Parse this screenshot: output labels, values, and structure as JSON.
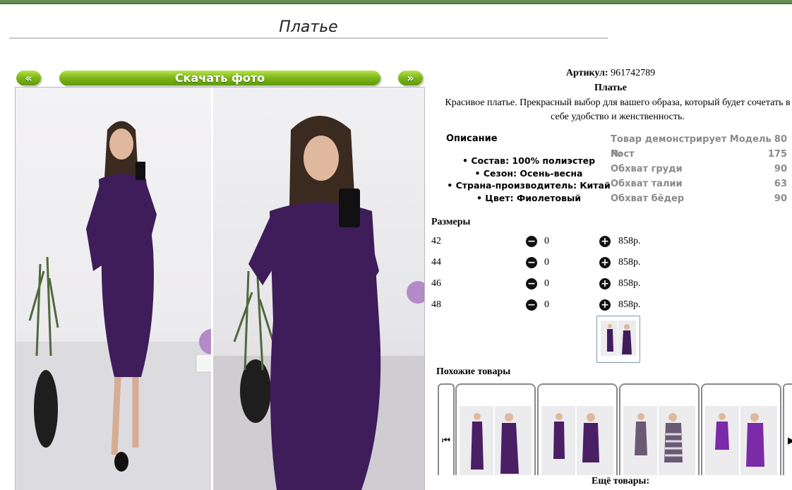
{
  "page": {
    "title": "Платье"
  },
  "gallery": {
    "prev_label": "«",
    "download_label": "Скачать фото",
    "next_label": "»"
  },
  "product": {
    "sku_label": "Артикул:",
    "sku_value": "961742789",
    "name": "Платье",
    "description": "Красивое платье. Прекрасный выбор для вашего образа, который будет сочетать в себе удобство и женственность."
  },
  "details": {
    "heading": "Описание",
    "items": [
      "Состав: 100% полиэстер",
      "Сезон: Осень-весна",
      "Страна-производитель: Китай",
      "Цвет: Фиолетовый"
    ]
  },
  "measurements": {
    "rows": [
      {
        "label": "Товар демонстрирует Модель №",
        "value": "80"
      },
      {
        "label": "Рост",
        "value": "175"
      },
      {
        "label": "Обхват груди",
        "value": "90"
      },
      {
        "label": "Обхват талии",
        "value": "63"
      },
      {
        "label": "Обхват бёдер",
        "value": "90"
      }
    ]
  },
  "sizes": {
    "heading": "Размеры",
    "rows": [
      {
        "size": "42",
        "qty": "0",
        "price": "858р."
      },
      {
        "size": "44",
        "qty": "0",
        "price": "858р."
      },
      {
        "size": "46",
        "qty": "0",
        "price": "858р."
      },
      {
        "size": "48",
        "qty": "0",
        "price": "858р."
      }
    ]
  },
  "similar": {
    "heading": "Похожие товары",
    "dress_colors": [
      "#4a1f66",
      "#4a1f66",
      "#6b5a76",
      "#7b2aa8"
    ]
  },
  "more_label": "Ещё товары:",
  "colors": {
    "accent_green": "#7cb518",
    "dress_purple": "#3e1d5a"
  }
}
